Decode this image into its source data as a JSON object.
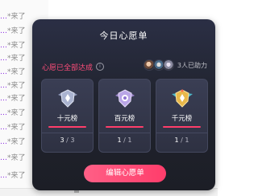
{
  "chat": {
    "rows": [
      {
        "prefix": "…",
        "suffix": "来了"
      },
      {
        "prefix": "…",
        "suffix": "来了"
      },
      {
        "prefix": "…",
        "suffix": "来了"
      },
      {
        "prefix": "…",
        "suffix": "来了"
      },
      {
        "prefix": "…",
        "suffix": "来了"
      },
      {
        "prefix": "…",
        "suffix": "来了"
      },
      {
        "prefix": "…",
        "suffix": "来了"
      },
      {
        "prefix": "…",
        "suffix": "来了"
      },
      {
        "prefix": "…",
        "suffix": "来了"
      },
      {
        "prefix": "…",
        "suffix": "来了"
      },
      {
        "prefix": "…",
        "suffix": "来了"
      },
      {
        "prefix": "…",
        "suffix": "来了"
      }
    ],
    "accent_color": "#8a2be2"
  },
  "modal": {
    "title": "今日心愿单",
    "status_text": "心愿已全部达成",
    "info_icon": "info-icon",
    "helpers_text": "3人已助力",
    "cards": [
      {
        "label": "十元榜",
        "done": "3",
        "sep": "/",
        "total": "3",
        "badge": "silver-shield-badge"
      },
      {
        "label": "百元榜",
        "done": "1",
        "sep": "/",
        "total": "1",
        "badge": "purple-shield-badge"
      },
      {
        "label": "千元榜",
        "done": "1",
        "sep": "/",
        "total": "1",
        "badge": "gold-winged-badge"
      }
    ],
    "edit_button_label": "编辑心愿单",
    "accent_color": "#ff3d6b"
  }
}
